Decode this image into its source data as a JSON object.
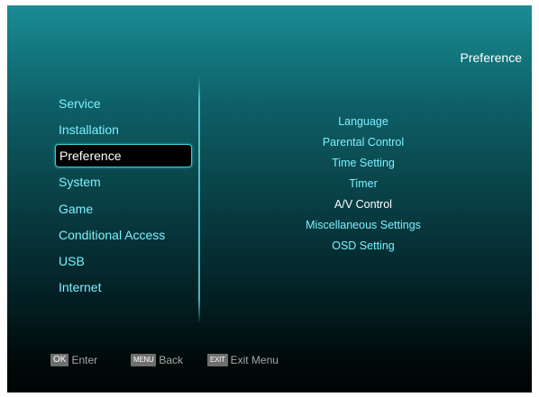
{
  "header": {
    "title": "Preference"
  },
  "main_menu": {
    "items": [
      {
        "label": "Service"
      },
      {
        "label": "Installation"
      },
      {
        "label": "Preference"
      },
      {
        "label": "System"
      },
      {
        "label": "Game"
      },
      {
        "label": "Conditional Access"
      },
      {
        "label": "USB"
      },
      {
        "label": "Internet"
      }
    ],
    "selected": "Preference"
  },
  "sub_menu": {
    "items": [
      {
        "label": "Language"
      },
      {
        "label": "Parental Control"
      },
      {
        "label": "Time Setting"
      },
      {
        "label": "Timer"
      },
      {
        "label": "A/V Control"
      },
      {
        "label": "Miscellaneous Settings"
      },
      {
        "label": "OSD Setting"
      }
    ],
    "highlighted": "A/V Control"
  },
  "footer": {
    "ok": {
      "key": "OK",
      "label": "Enter"
    },
    "menu": {
      "key": "MENU",
      "label": "Back"
    },
    "exit": {
      "key": "EXIT",
      "label": "Exit Menu"
    }
  },
  "colors": {
    "accent_text": "#7cf0ff",
    "selected_border": "#46c8d2",
    "background_top": "#1a8c94",
    "background_bottom": "#000505",
    "key_badge": "#6f6f6f"
  }
}
